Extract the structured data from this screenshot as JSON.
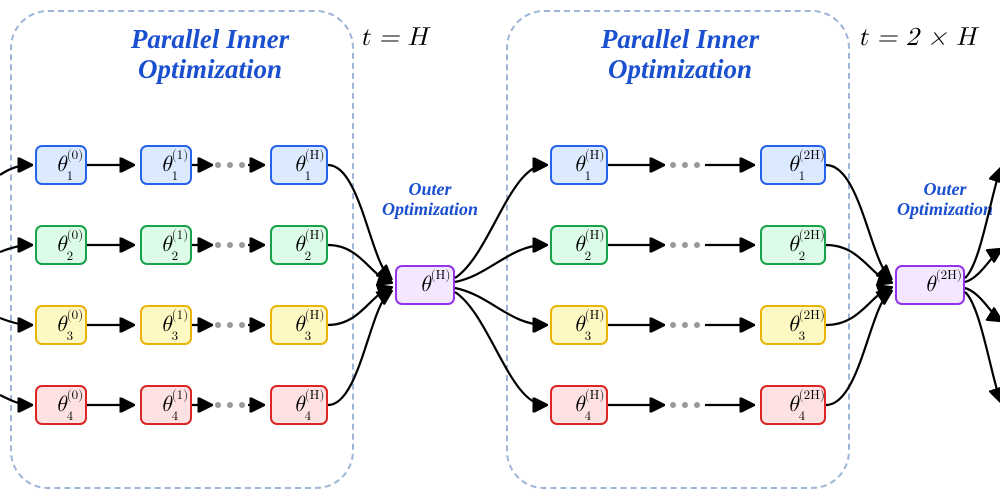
{
  "blocks": [
    {
      "title_line1": "Parallel Inner",
      "title_line2": "Optimization",
      "step_label": "t = H",
      "outer_label1": "Outer",
      "outer_label2": "Optimization",
      "outer_node_sup": "(H)",
      "cols": [
        {
          "sup": "(0)"
        },
        {
          "sup": "(1)"
        },
        {
          "sup": "(H)"
        }
      ]
    },
    {
      "title_line1": "Parallel Inner",
      "title_line2": "Optimization",
      "step_label": "t = 2 × H",
      "outer_label1": "Outer",
      "outer_label2": "Optimization",
      "outer_node_sup": "(2H)",
      "cols": [
        {
          "sup": "(H)"
        },
        {
          "sup": "(2H)"
        }
      ]
    }
  ],
  "rows": [
    {
      "sub": "1",
      "fill": "#dbeafe",
      "stroke": "#2563eb"
    },
    {
      "sub": "2",
      "fill": "#dcfce7",
      "stroke": "#16a34a"
    },
    {
      "sub": "3",
      "fill": "#fef9c3",
      "stroke": "#eab308"
    },
    {
      "sub": "4",
      "fill": "#fee2e2",
      "stroke": "#dc2626"
    }
  ],
  "outer_node": {
    "fill": "#f3e8ff",
    "stroke": "#9333ea"
  },
  "theta": "θ"
}
